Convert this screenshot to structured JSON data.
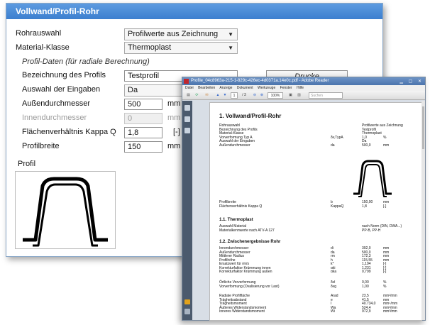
{
  "dialog": {
    "title": "Vollwand/Profil-Rohr",
    "rohrauswahl_label": "Rohrauswahl",
    "rohrauswahl_value": "Profilwerte aus Zeichnung",
    "material_label": "Material-Klasse",
    "material_value": "Thermoplast",
    "section_label": "Profil-Daten (für radiale Berechnung)",
    "bezeichnung_label": "Bezeichnung des Profils",
    "bezeichnung_value": "Testprofil",
    "print_button": "Drucke Profilergebnisse",
    "auswahl_label": "Auswahl der Eingaben",
    "auswahl_value": "Da",
    "aussen_label": "Außendurchmesser",
    "aussen_value": "500",
    "aussen_unit": "mm",
    "innen_label": "Innendurchmesser",
    "innen_value": "0",
    "innen_unit": "mm",
    "kappa_label": "Flächenverhältnis Kappa Q",
    "kappa_value": "1,8",
    "kappa_unit": "[-]",
    "breite_label": "Profilbreite",
    "breite_value": "150",
    "breite_unit": "mm",
    "profil_label": "Profil",
    "accent": "#4a8ad8"
  },
  "viewer": {
    "title": "Profile_04c8963a-215-1-829c-426ec-4d0371a.14e0c.pdf - Adobe Reader",
    "menu": [
      "Datei",
      "Bearbeiten",
      "Anzeige",
      "Dokument",
      "Werkzeuge",
      "Fenster",
      "Hilfe"
    ],
    "toolbar": {
      "page": "1",
      "page_total": "/ 3",
      "zoom": "100%",
      "search": "Suchen"
    },
    "doc": {
      "heading": "1. Vollwand/Profil-Rohr",
      "block1": [
        [
          "Rohrauswahl",
          "",
          "Profilwerte aus Zeichnung",
          ""
        ],
        [
          "Bezeichnung des Profils",
          "",
          "Testprofil",
          ""
        ],
        [
          "Material-Klasse",
          "",
          "Thermoplast",
          ""
        ],
        [
          "Vorverformung Typ A",
          "δv,TypA",
          "1,0",
          "%"
        ],
        [
          "Auswahl der Eingaben",
          "",
          "Da",
          ""
        ],
        [
          "Außendurchmesser",
          "da",
          "500,0",
          "mm"
        ]
      ],
      "block2": [
        [
          "Profilbreite",
          "b",
          "150,00",
          "mm"
        ],
        [
          "Flächenverhältnis Kappa Q",
          "KappaQ",
          "1,8",
          "[-]"
        ]
      ],
      "sub1": "1.1. Thermoplast",
      "block3": [
        [
          "Auswahl Material",
          "",
          "nach Norm (DIN, DWA...)",
          ""
        ],
        [
          "Materialkennwerte nach ATV-A 127",
          "",
          "PP-B, PP-H",
          ""
        ]
      ],
      "sub2": "1.2. Zwischenergebnisse Rohr",
      "block4": [
        [
          "Innendurchmesser",
          "di",
          "392,0",
          "mm"
        ],
        [
          "Außendurchmesser",
          "da",
          "500,0",
          "mm"
        ],
        [
          "Mittlerer Radius",
          "rm",
          "172,3",
          "mm"
        ],
        [
          "Profilhöhe",
          "h",
          "115,55",
          "mm"
        ],
        [
          "Ersatzwert für rm/s",
          "k*",
          "1,194",
          "[-]"
        ],
        [
          "Korrekturfaktor Krümmung innen",
          "αki",
          "1,231",
          "[-]"
        ],
        [
          "Korrekturfaktor Krümmung außen",
          "αka",
          "0,799",
          "[-]"
        ]
      ],
      "block5": [
        [
          "Örtliche Vorverformung",
          "δvl",
          "0,00",
          "%"
        ],
        [
          "Vorverformung (Ovalisierung vor Last)",
          "δvg",
          "1,00",
          "%"
        ]
      ],
      "block6": [
        [
          "Radiale Profilfläche",
          "Arad",
          "23,5",
          "mm²/mm"
        ],
        [
          "Trägheitsabstand",
          "e",
          "41,5",
          "mm"
        ],
        [
          "Trägheitsmoment",
          "I",
          "40.734,0",
          "mm⁴/mm"
        ],
        [
          "Äußeres Widerstandsmoment",
          "Wa",
          "524,4",
          "mm³/mm"
        ],
        [
          "Inneres Widerstandsmoment",
          "Wi",
          "972,9",
          "mm³/mm"
        ]
      ]
    }
  }
}
